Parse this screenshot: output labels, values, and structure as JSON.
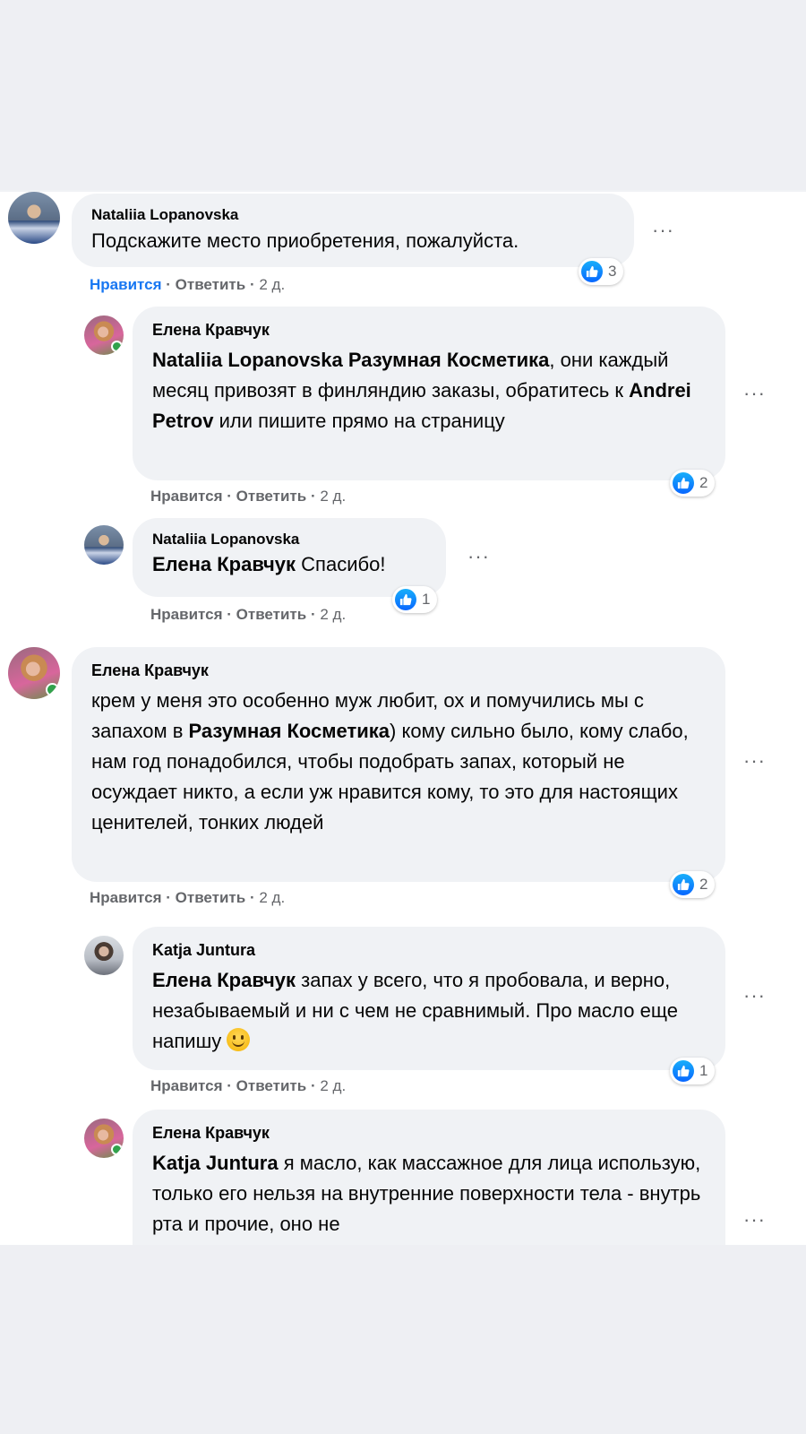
{
  "comments": [
    {
      "author": "Nataliia Lopanovska",
      "text": "Подскажите место приобретения, пожалуйста.",
      "like_label": "Нравится",
      "reply_label": "Ответить",
      "time": "2 д.",
      "reactions": "3",
      "liked": true,
      "avatar": "avatar-nataliia"
    },
    {
      "author": "Елена Кравчук",
      "mention1": "Nataliia Lopanovska Разумная Косметика",
      "text1": ", они каждый месяц привозят в финляндию заказы, обратитесь к ",
      "mention2": "Andrei Petrov",
      "text2": " или пишите прямо на страницу",
      "like_label": "Нравится",
      "reply_label": "Ответить",
      "time": "2 д.",
      "reactions": "2",
      "avatar": "avatar-elena"
    },
    {
      "author": "Nataliia Lopanovska",
      "mention1": "Елена Кравчук",
      "text1": " Спасибо!",
      "like_label": "Нравится",
      "reply_label": "Ответить",
      "time": "2 д.",
      "reactions": "1",
      "avatar": "avatar-nataliia"
    },
    {
      "author": "Елена Кравчук",
      "text1": "крем у меня это особенно муж любит, ох и помучились мы с запахом в ",
      "mention1": "Разумная Косметика",
      "text2": ") кому сильно было, кому слабо, нам год понадобился, чтобы подобрать запах, который не осуждает никто, а если уж нравится кому, то это для настоящих ценителей, тонких людей",
      "like_label": "Нравится",
      "reply_label": "Ответить",
      "time": "2 д.",
      "reactions": "2",
      "avatar": "avatar-elena"
    },
    {
      "author": "Katja Juntura",
      "mention1": "Елена Кравчук",
      "text1": " запах у всего, что я пробовала, и верно, незабываемый и ни с чем не сравнимый. Про масло еще напишу ",
      "emoji": "smile-emoji",
      "like_label": "Нравится",
      "reply_label": "Ответить",
      "time": "2 д.",
      "reactions": "1",
      "avatar": "avatar-katja"
    },
    {
      "author": "Елена Кравчук",
      "mention1": "Katja Juntura",
      "text1": " я масло, как массажное для лица использую, только его нельзя на внутренние поверхности тела - внутрь рта и прочие, оно не",
      "avatar": "avatar-elena"
    }
  ],
  "ui": {
    "more_glyph": "···",
    "separator": "·",
    "colors": {
      "like_blue": "#1877f2",
      "bubble_bg": "#f0f2f5",
      "online_green": "#31a24c"
    }
  }
}
